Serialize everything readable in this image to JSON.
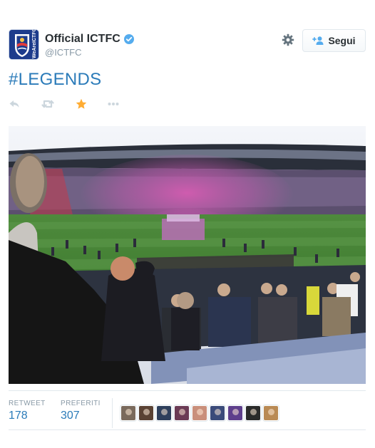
{
  "user": {
    "full_name": "Official ICTFC",
    "handle": "@ICTFC",
    "verified": true,
    "avatar_icon": "club-crest-icon"
  },
  "follow_button": {
    "label": "Segui",
    "icon": "follow-user-icon"
  },
  "tweet": {
    "text": "#LEGENDS"
  },
  "actions": {
    "reply_icon": "reply-icon",
    "retweet_icon": "retweet-icon",
    "favorite_icon": "star-icon",
    "favorited": true,
    "more_icon": "more-icon"
  },
  "stats": {
    "retweets_label": "RETWEET",
    "retweets_count": "178",
    "favorites_label": "PREFERITI",
    "favorites_count": "307"
  },
  "favoriters": [
    {
      "color": "#7a6a5c"
    },
    {
      "color": "#5a4234"
    },
    {
      "color": "#2e3f5c"
    },
    {
      "color": "#6b3b55"
    },
    {
      "color": "#c98f7b"
    },
    {
      "color": "#3b4b7a"
    },
    {
      "color": "#5e3f8c"
    },
    {
      "color": "#2a2a2a"
    },
    {
      "color": "#b98a54"
    }
  ],
  "colors": {
    "link": "#2b7bb9",
    "muted": "#8899a6",
    "star": "#ffac33",
    "verified": "#55acee"
  }
}
